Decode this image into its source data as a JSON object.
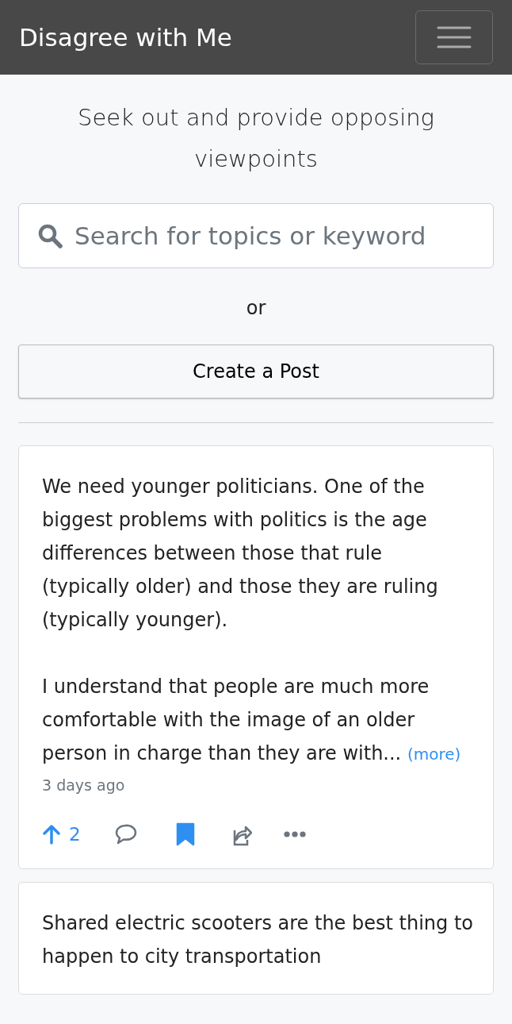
{
  "navbar": {
    "brand": "Disagree with Me"
  },
  "tagline": "Seek out and provide opposing viewpoints",
  "search": {
    "placeholder": "Search for topics or keyword"
  },
  "separator": "or",
  "create_button": "Create a Post",
  "posts": [
    {
      "paragraphs": [
        "We need younger politicians. One of the biggest problems with politics is the age differences between those that rule (typically older) and those they are ruling (typically younger).",
        "I understand that people are much more comfortable with the image of an older person in charge than they are with..."
      ],
      "more_link": "(more)",
      "time": "3 days ago",
      "upvoted": true,
      "votes": "2",
      "bookmarked": true
    },
    {
      "paragraphs": [
        "Shared electric scooters are the best thing to happen to city transportation"
      ]
    }
  ]
}
